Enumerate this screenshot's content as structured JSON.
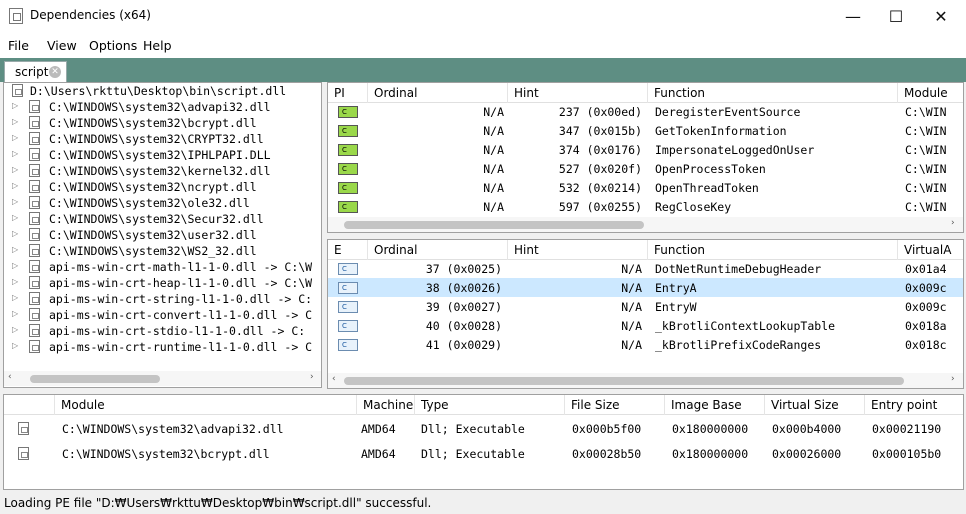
{
  "window": {
    "title": "Dependencies (x64)",
    "minimize": "—",
    "maximize": "☐",
    "close": "✕"
  },
  "menu": {
    "file": "File",
    "view": "View",
    "options": "Options",
    "help": "Help"
  },
  "tab": {
    "label": "script",
    "close": "✕"
  },
  "tree": {
    "root": "D:\\Users\\rkttu\\Desktop\\bin\\script.dll",
    "items": [
      "C:\\WINDOWS\\system32\\advapi32.dll",
      "C:\\WINDOWS\\system32\\bcrypt.dll",
      "C:\\WINDOWS\\system32\\CRYPT32.dll",
      "C:\\WINDOWS\\system32\\IPHLPAPI.DLL",
      "C:\\WINDOWS\\system32\\kernel32.dll",
      "C:\\WINDOWS\\system32\\ncrypt.dll",
      "C:\\WINDOWS\\system32\\ole32.dll",
      "C:\\WINDOWS\\system32\\Secur32.dll",
      "C:\\WINDOWS\\system32\\user32.dll",
      "C:\\WINDOWS\\system32\\WS2_32.dll",
      "api-ms-win-crt-math-l1-1-0.dll -> C:\\W",
      "api-ms-win-crt-heap-l1-1-0.dll -> C:\\W",
      "api-ms-win-crt-string-l1-1-0.dll -> C:",
      "api-ms-win-crt-convert-l1-1-0.dll -> C",
      "api-ms-win-crt-stdio-l1-1-0.dll -> C:",
      "api-ms-win-crt-runtime-l1-1-0.dll -> C"
    ]
  },
  "imports": {
    "headers": [
      "PI",
      "Ordinal",
      "Hint",
      "Function",
      "Module"
    ],
    "rows": [
      {
        "icon": "C",
        "ordinal": "N/A",
        "hint": "237 (0x00ed)",
        "function": "DeregisterEventSource",
        "module": "C:\\WIN"
      },
      {
        "icon": "C",
        "ordinal": "N/A",
        "hint": "347 (0x015b)",
        "function": "GetTokenInformation",
        "module": "C:\\WIN"
      },
      {
        "icon": "C",
        "ordinal": "N/A",
        "hint": "374 (0x0176)",
        "function": "ImpersonateLoggedOnUser",
        "module": "C:\\WIN"
      },
      {
        "icon": "C",
        "ordinal": "N/A",
        "hint": "527 (0x020f)",
        "function": "OpenProcessToken",
        "module": "C:\\WIN"
      },
      {
        "icon": "C",
        "ordinal": "N/A",
        "hint": "532 (0x0214)",
        "function": "OpenThreadToken",
        "module": "C:\\WIN"
      },
      {
        "icon": "C",
        "ordinal": "N/A",
        "hint": "597 (0x0255)",
        "function": "RegCloseKey",
        "module": "C:\\WIN"
      }
    ]
  },
  "exports": {
    "headers": [
      "E",
      "Ordinal",
      "Hint",
      "Function",
      "VirtualA"
    ],
    "rows": [
      {
        "icon": "C",
        "ordinal": "37 (0x0025)",
        "hint": "N/A",
        "function": "DotNetRuntimeDebugHeader",
        "va": "0x01a4"
      },
      {
        "icon": "C",
        "ordinal": "38 (0x0026)",
        "hint": "N/A",
        "function": "EntryA",
        "va": "0x009c"
      },
      {
        "icon": "C",
        "ordinal": "39 (0x0027)",
        "hint": "N/A",
        "function": "EntryW",
        "va": "0x009c"
      },
      {
        "icon": "C",
        "ordinal": "40 (0x0028)",
        "hint": "N/A",
        "function": "_kBrotliContextLookupTable",
        "va": "0x018a"
      },
      {
        "icon": "C",
        "ordinal": "41 (0x0029)",
        "hint": "N/A",
        "function": "_kBrotliPrefixCodeRanges",
        "va": "0x018c"
      }
    ]
  },
  "modules": {
    "headers": [
      "Module",
      "Machine",
      "Type",
      "File Size",
      "Image Base",
      "Virtual Size",
      "Entry point"
    ],
    "rows": [
      {
        "module": "C:\\WINDOWS\\system32\\advapi32.dll",
        "machine": "AMD64",
        "type": "Dll; Executable",
        "file_size": "0x000b5f00",
        "image_base": "0x180000000",
        "virtual_size": "0x000b4000",
        "entry": "0x00021190"
      },
      {
        "module": "C:\\WINDOWS\\system32\\bcrypt.dll",
        "machine": "AMD64",
        "type": "Dll; Executable",
        "file_size": "0x00028b50",
        "image_base": "0x180000000",
        "virtual_size": "0x00026000",
        "entry": "0x000105b0"
      }
    ]
  },
  "status": {
    "text": "Loading PE file \"D:₩Users₩rkttu₩Desktop₩bin₩script.dll\" successful."
  }
}
